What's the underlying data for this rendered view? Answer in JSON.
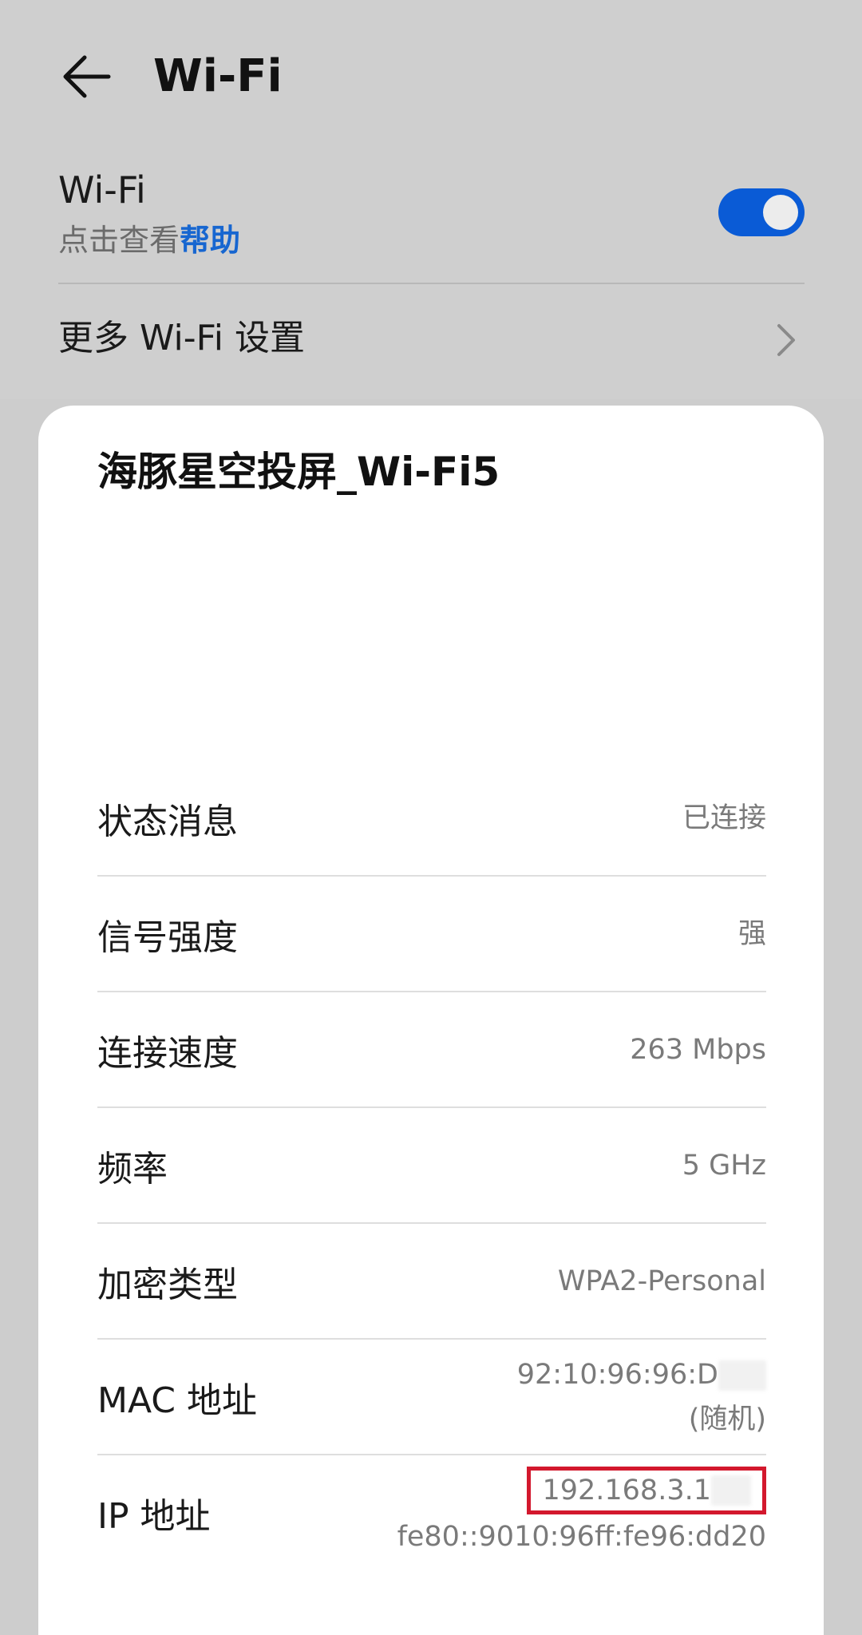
{
  "header": {
    "title": "Wi-Fi",
    "back_icon": "arrow-left-icon"
  },
  "wifi_toggle": {
    "label": "Wi-Fi",
    "help_prefix": "点击查看",
    "help_link": "帮助",
    "enabled": true,
    "accent_color": "#0a5bd6"
  },
  "more_settings": {
    "label": "更多 Wi-Fi 设置"
  },
  "network": {
    "name": "海豚星空投屏_Wi-Fi5",
    "details": [
      {
        "label": "状态消息",
        "value": "已连接"
      },
      {
        "label": "信号强度",
        "value": "强"
      },
      {
        "label": "连接速度",
        "value": "263 Mbps"
      },
      {
        "label": "频率",
        "value": "5 GHz"
      },
      {
        "label": "加密类型",
        "value": "WPA2-Personal"
      },
      {
        "label": "MAC 地址",
        "value": "92:10:96:96:D",
        "value_note": "(随机)"
      },
      {
        "label": "IP 地址",
        "value": "192.168.3.1",
        "value_secondary": "fe80::9010:96ff:fe96:dd20"
      }
    ]
  },
  "highlight_color": "#d3182d"
}
